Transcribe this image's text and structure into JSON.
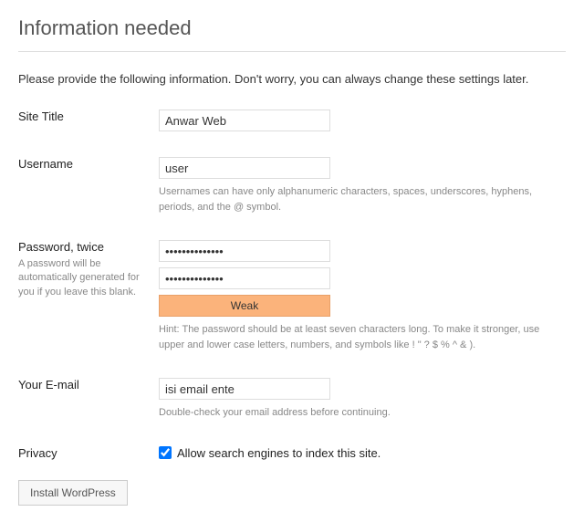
{
  "heading": "Information needed",
  "intro": "Please provide the following information. Don't worry, you can always change these settings later.",
  "fields": {
    "site_title": {
      "label": "Site Title",
      "value": "Anwar Web"
    },
    "username": {
      "label": "Username",
      "value": "user",
      "help": "Usernames can have only alphanumeric characters, spaces, underscores, hyphens, periods, and the @ symbol."
    },
    "password": {
      "label": "Password, twice",
      "label_help": "A password will be automatically generated for you if you leave this blank.",
      "value1": "••••••••••••••",
      "value2": "••••••••••••••",
      "strength": "Weak",
      "hint": "Hint: The password should be at least seven characters long. To make it stronger, use upper and lower case letters, numbers, and symbols like ! \" ? $ % ^ & )."
    },
    "email": {
      "label": "Your E-mail",
      "value": "isi email ente",
      "help": "Double-check your email address before continuing."
    },
    "privacy": {
      "label": "Privacy",
      "checkbox_label": "Allow search engines to index this site.",
      "checked": true
    }
  },
  "submit_label": "Install WordPress"
}
